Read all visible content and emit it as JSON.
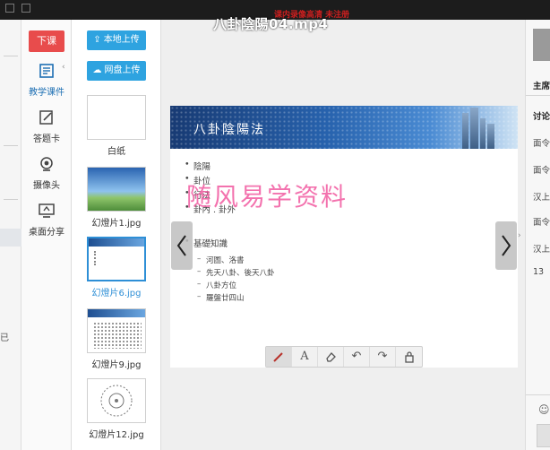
{
  "video": {
    "title": "八卦陰陽04.mp4",
    "notice": "课内录像高清  未注册"
  },
  "toolbar": {
    "end_label": "下课",
    "tools": [
      {
        "label": "教学课件",
        "icon": "courseware-icon",
        "active": true
      },
      {
        "label": "答题卡",
        "icon": "answer-card-icon",
        "active": false
      },
      {
        "label": "摄像头",
        "icon": "camera-icon",
        "active": false
      },
      {
        "label": "桌面分享",
        "icon": "desktop-share-icon",
        "active": false
      }
    ]
  },
  "left_strip": {
    "tail_text": "已"
  },
  "thumbnails": {
    "local_upload": "本地上传",
    "cloud_upload": "网盘上传",
    "items": [
      {
        "label": "白纸",
        "selected": false
      },
      {
        "label": "幻燈片1.jpg",
        "selected": false
      },
      {
        "label": "幻燈片6.jpg",
        "selected": true
      },
      {
        "label": "幻燈片9.jpg",
        "selected": false
      },
      {
        "label": "幻燈片12.jpg",
        "selected": false
      }
    ]
  },
  "slide": {
    "title": "八卦陰陽法",
    "bullets": [
      "陰陽",
      "卦位",
      "行法",
      "卦內 . 卦外"
    ],
    "section": "基礎知識",
    "sub_items": [
      "河圖、洛書",
      "先天八卦、後天八卦",
      "八卦方位",
      "羅盤廿四山"
    ],
    "watermark": "随风易学资料"
  },
  "draw_tools": [
    {
      "name": "pen-tool",
      "glyph": "✎"
    },
    {
      "name": "text-tool",
      "glyph": "A"
    },
    {
      "name": "eraser-tool",
      "glyph": "⌫"
    },
    {
      "name": "undo-tool",
      "glyph": "↶"
    },
    {
      "name": "redo-tool",
      "glyph": "↷"
    },
    {
      "name": "lock-tool",
      "glyph": "🔒"
    }
  ],
  "right_panel": {
    "host_label": "主席",
    "discuss_label": "讨论",
    "lines": [
      "面令",
      "面令",
      "汉上",
      "面令",
      "汉上",
      "13"
    ]
  },
  "colors": {
    "accent": "#2ea3e0",
    "end_button": "#e84c4c",
    "watermark": "#f25aa0",
    "banner": "#2762ad"
  }
}
